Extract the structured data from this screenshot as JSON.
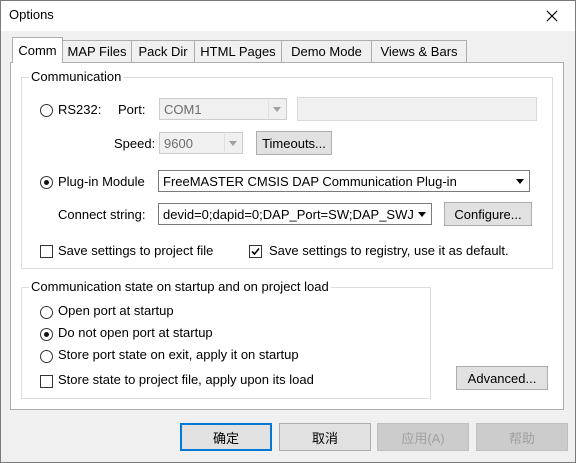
{
  "window": {
    "title": "Options"
  },
  "tabs": [
    {
      "label": "Comm",
      "active": true
    },
    {
      "label": "MAP Files"
    },
    {
      "label": "Pack Dir"
    },
    {
      "label": "HTML Pages"
    },
    {
      "label": "Demo Mode"
    },
    {
      "label": "Views & Bars"
    }
  ],
  "communication": {
    "group_label": "Communication",
    "rs232": {
      "radio_label": "RS232:",
      "port_label": "Port:",
      "port_value": "COM1",
      "speed_label": "Speed:",
      "speed_value": "9600",
      "timeouts_label": "Timeouts..."
    },
    "plugin": {
      "radio_label": "Plug-in Module",
      "module_value": "FreeMASTER CMSIS DAP Communication Plug-in",
      "connect_label": "Connect string:",
      "connect_value": "devid=0;dapid=0;DAP_Port=SW;DAP_SWJ",
      "configure_label": "Configure..."
    },
    "save_project_label": "Save settings to project file",
    "save_registry_label": "Save settings to registry, use it as default."
  },
  "startup": {
    "group_label": "Communication state on startup and on project load",
    "open_port_label": "Open port at startup",
    "do_not_open_label": "Do not open port at startup",
    "store_port_label": "Store port state on exit, apply it on startup",
    "store_project_label": "Store state to project file, apply upon its load",
    "advanced_label": "Advanced..."
  },
  "footer": {
    "ok_label": "确定",
    "cancel_label": "取消",
    "apply_label": "应用(A)",
    "help_label": "帮助"
  }
}
